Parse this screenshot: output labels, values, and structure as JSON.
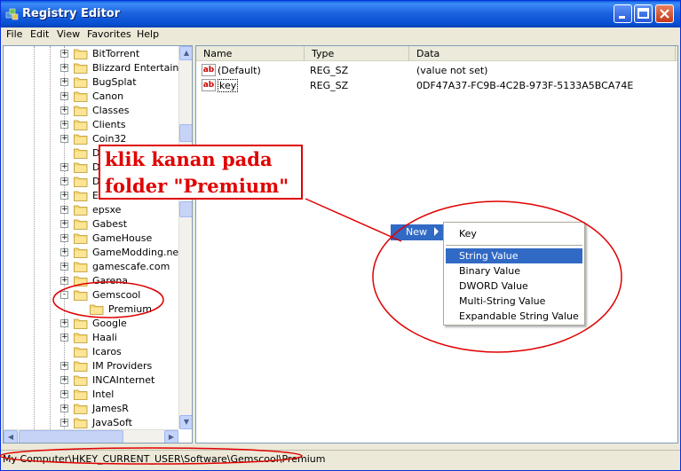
{
  "window": {
    "title": "Registry Editor"
  },
  "menu": [
    "File",
    "Edit",
    "View",
    "Favorites",
    "Help"
  ],
  "tree": {
    "items": [
      {
        "label": "BitTorrent",
        "expander": "+"
      },
      {
        "label": "Blizzard Entertainme",
        "expander": "+"
      },
      {
        "label": "BugSplat",
        "expander": "+"
      },
      {
        "label": "Canon",
        "expander": "+"
      },
      {
        "label": "Classes",
        "expander": "+"
      },
      {
        "label": "Clients",
        "expander": "+"
      },
      {
        "label": "Coin32",
        "expander": "+"
      },
      {
        "label": "Dol",
        "expander": ""
      },
      {
        "label": "Dow",
        "expander": "+"
      },
      {
        "label": "DSC",
        "expander": "+"
      },
      {
        "label": "Eas",
        "expander": "+"
      },
      {
        "label": "epsxe",
        "expander": "+"
      },
      {
        "label": "Gabest",
        "expander": "+"
      },
      {
        "label": "GameHouse",
        "expander": "+"
      },
      {
        "label": "GameModding.net",
        "expander": "+"
      },
      {
        "label": "gamescafe.com",
        "expander": "+"
      },
      {
        "label": "Garena",
        "expander": "+"
      },
      {
        "label": "Gemscool",
        "expander": "-"
      },
      {
        "label": "Premium",
        "expander": "",
        "child": true,
        "selected": true
      },
      {
        "label": "Google",
        "expander": "+"
      },
      {
        "label": "Haali",
        "expander": "+"
      },
      {
        "label": "Icaros",
        "expander": ""
      },
      {
        "label": "IM Providers",
        "expander": "+"
      },
      {
        "label": "INCAInternet",
        "expander": "+"
      },
      {
        "label": "Intel",
        "expander": "+"
      },
      {
        "label": "JamesR",
        "expander": "+"
      },
      {
        "label": "JavaSoft",
        "expander": "+"
      }
    ]
  },
  "list": {
    "columns": [
      "Name",
      "Type",
      "Data"
    ],
    "rows": [
      {
        "name": "(Default)",
        "type": "REG_SZ",
        "data": "(value not set)"
      },
      {
        "name": "key",
        "type": "REG_SZ",
        "data": "0DF47A37-FC9B-4C2B-973F-5133A5BCA74E"
      }
    ]
  },
  "context_menu": {
    "new_label": "New",
    "items": [
      "Key",
      "String Value",
      "Binary Value",
      "DWORD Value",
      "Multi-String Value",
      "Expandable String Value"
    ],
    "highlighted": "String Value"
  },
  "annotation": {
    "line1": "klik kanan pada",
    "line2": "folder \"Premium\""
  },
  "status": {
    "path": "My Computer\\HKEY_CURRENT_USER\\Software\\Gemscool\\Premium"
  },
  "colors": {
    "title_blue": "#0a5fe0",
    "annotation_red": "#e00000",
    "selection_blue": "#316ac5"
  }
}
